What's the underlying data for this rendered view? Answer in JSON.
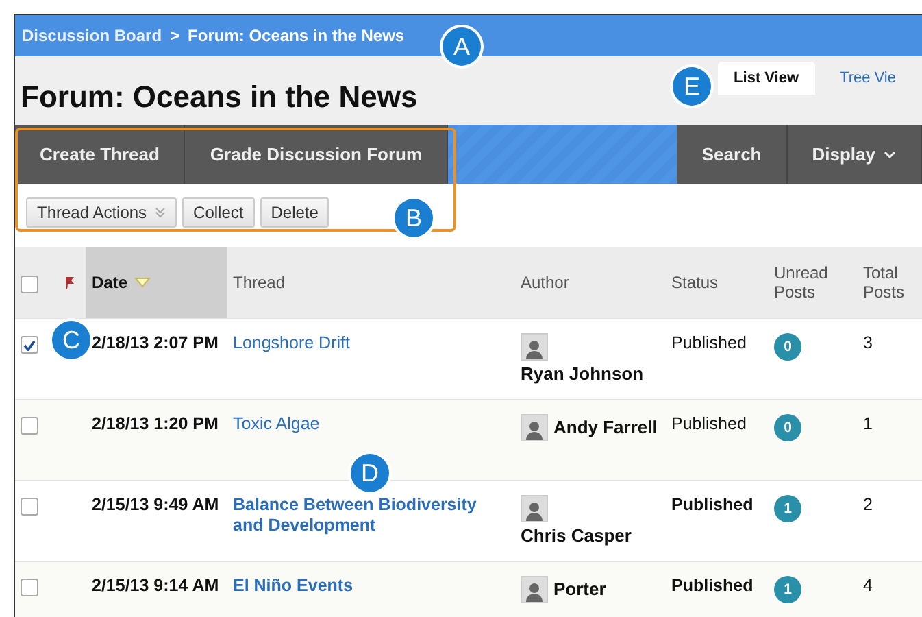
{
  "breadcrumb": {
    "items": [
      "Discussion Board",
      "Forum: Oceans in the News"
    ],
    "separator": ">"
  },
  "page_title": "Forum: Oceans in the News",
  "view_tabs": [
    {
      "label": "List View",
      "selected": true
    },
    {
      "label": "Tree Vie",
      "selected": false
    }
  ],
  "action_bar": {
    "left": [
      "Create Thread",
      "Grade Discussion Forum"
    ],
    "right": [
      "Search",
      "Display"
    ]
  },
  "toolbar": {
    "dropdown": "Thread Actions",
    "buttons": [
      "Collect",
      "Delete"
    ]
  },
  "table": {
    "columns": [
      "Date",
      "Thread",
      "Author",
      "Status",
      "Unread Posts",
      "Total Posts"
    ],
    "select_all_checked": false,
    "rows": [
      {
        "checked": true,
        "unread": false,
        "date": "2/18/13 2:07 PM",
        "thread": "Longshore Drift",
        "author": "Ryan Johnson",
        "status": "Published",
        "unread_posts": "0",
        "total_posts": "3"
      },
      {
        "checked": false,
        "unread": false,
        "date": "2/18/13 1:20 PM",
        "thread": "Toxic Algae",
        "author": "Andy Farrell",
        "status": "Published",
        "unread_posts": "0",
        "total_posts": "1"
      },
      {
        "checked": false,
        "unread": true,
        "date": "2/15/13 9:49 AM",
        "thread": "Balance Between Biodiversity and Development",
        "author": "Chris Casper",
        "status": "Published",
        "unread_posts": "1",
        "total_posts": "2"
      },
      {
        "checked": false,
        "unread": true,
        "date": "2/15/13 9:14 AM",
        "thread": "El Niño Events",
        "author": "Porter",
        "status": "Published",
        "unread_posts": "1",
        "total_posts": "4"
      }
    ]
  },
  "callouts": [
    "A",
    "B",
    "C",
    "D",
    "E"
  ]
}
